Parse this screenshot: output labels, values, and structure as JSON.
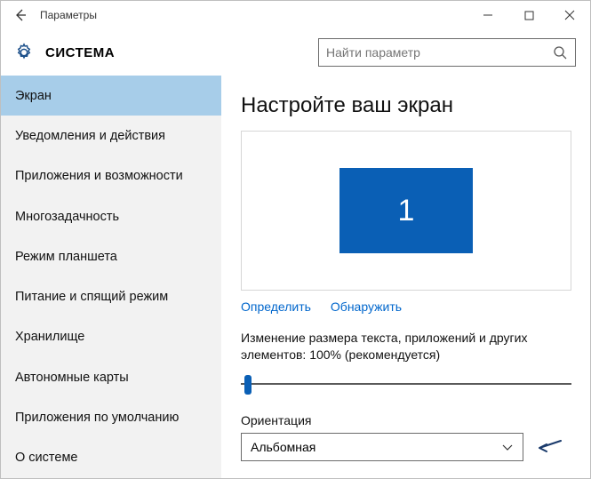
{
  "titlebar": {
    "title": "Параметры"
  },
  "header": {
    "app_title": "СИСТЕМА",
    "search_placeholder": "Найти параметр"
  },
  "sidebar": {
    "items": [
      {
        "label": "Экран"
      },
      {
        "label": "Уведомления и действия"
      },
      {
        "label": "Приложения и возможности"
      },
      {
        "label": "Многозадачность"
      },
      {
        "label": "Режим планшета"
      },
      {
        "label": "Питание и спящий режим"
      },
      {
        "label": "Хранилище"
      },
      {
        "label": "Автономные карты"
      },
      {
        "label": "Приложения по умолчанию"
      },
      {
        "label": "О системе"
      }
    ]
  },
  "main": {
    "heading": "Настройте ваш экран",
    "monitor_number": "1",
    "link_identify": "Определить",
    "link_detect": "Обнаружить",
    "size_label": "Изменение размера текста, приложений и других элементов: 100% (рекомендуется)",
    "orientation_label": "Ориентация",
    "orientation_value": "Альбомная"
  }
}
